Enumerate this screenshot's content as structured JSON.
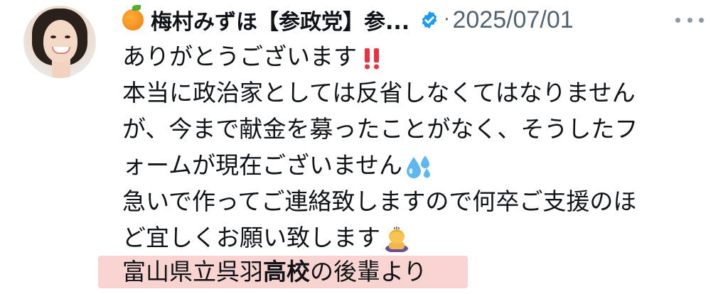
{
  "post": {
    "author": {
      "display_name": "梅村みずほ【参政党】参...",
      "name_emoji": "orange-emoji",
      "verified": true,
      "verified_color": "#1d9bf0"
    },
    "separator": "·",
    "date": "2025/07/01",
    "more_icon": "more-horizontal-icon",
    "body_lines": [
      "ありがとうございます",
      "本当に政治家としては反省しなくてはなりません",
      "が、今まで献金を募ったことがなく、そうしたフ",
      "ォームが現在ございません",
      "急いで作ってご連絡致しますので何卒ご支援のほ",
      "ど宜しくお願い致します"
    ],
    "emojis": {
      "line1": "double-exclamation-emoji",
      "line4": "sweat-droplets-emoji",
      "line6": "bowing-person-emoji"
    },
    "highlight": {
      "text_before": "富山県立呉羽",
      "text_bold": "高校",
      "text_after": "の後輩より",
      "background": "#f9d3d0"
    }
  }
}
